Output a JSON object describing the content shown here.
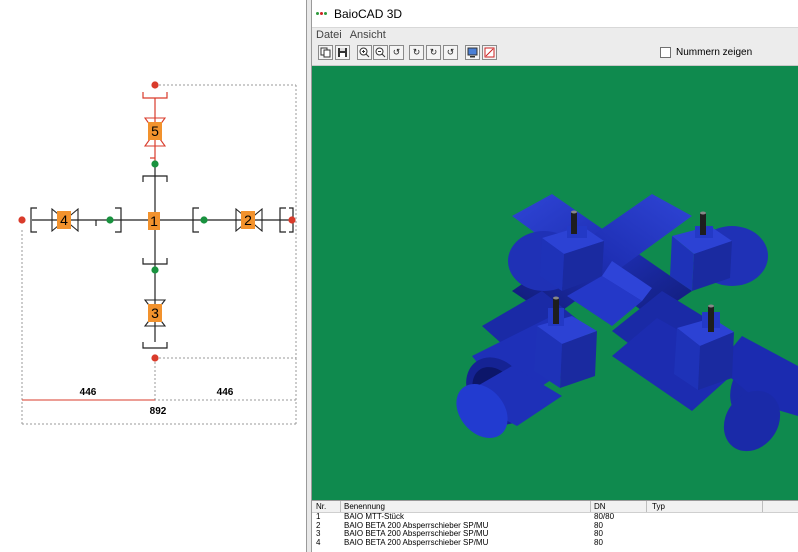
{
  "app": {
    "title": "BaioCAD 3D",
    "logo_colors": [
      "#2e9a3c",
      "#cc2222",
      "#2e9a3c"
    ]
  },
  "menu": {
    "items": [
      "Datei",
      "Ansicht"
    ]
  },
  "toolbar": {
    "buttons": [
      "copy-icon",
      "save-icon",
      "zoom-in-icon",
      "zoom-out-icon",
      "rotate-left-icon",
      "rotate-down-icon",
      "rotate-right-icon",
      "rotate-up-icon",
      "screen-icon",
      "print-icon"
    ],
    "numbers_checkbox": {
      "label": "Nummern zeigen",
      "checked": false
    }
  },
  "diagram": {
    "components": [
      {
        "number": "1",
        "type": "tee"
      },
      {
        "number": "2",
        "type": "valve"
      },
      {
        "number": "3",
        "type": "valve"
      },
      {
        "number": "4",
        "type": "valve"
      },
      {
        "number": "5",
        "type": "valve"
      }
    ],
    "dimensions": {
      "left": "446",
      "right": "446",
      "total": "892"
    },
    "colors": {
      "pipe": "#222222",
      "highlight": "#d93b2b",
      "node_open": "#d93b2b",
      "node_connected": "#18923e",
      "label_fill": "#f2922d"
    }
  },
  "viewport": {
    "background": "#0f8a4e",
    "model_color": "#2233b0"
  },
  "parts_table": {
    "columns": [
      "Nr.",
      "Benennung",
      "DN",
      "Typ"
    ],
    "rows": [
      {
        "nr": "1",
        "name": "BAIO MTT-Stück",
        "dn": "80/80",
        "typ": ""
      },
      {
        "nr": "2",
        "name": "BAIO BETA 200 Absperrschieber SP/MU",
        "dn": "80",
        "typ": ""
      },
      {
        "nr": "3",
        "name": "BAIO BETA 200 Absperrschieber SP/MU",
        "dn": "80",
        "typ": ""
      },
      {
        "nr": "4",
        "name": "BAIO BETA 200 Absperrschieber SP/MU",
        "dn": "80",
        "typ": ""
      }
    ]
  }
}
